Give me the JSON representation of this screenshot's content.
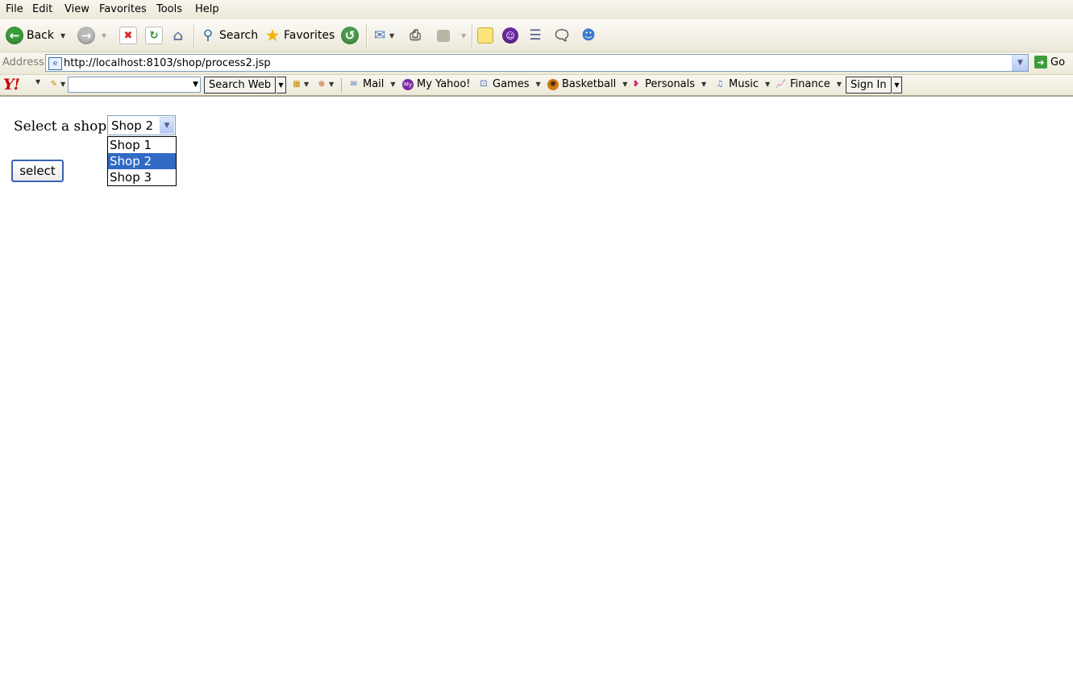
{
  "menu": [
    "File",
    "Edit",
    "View",
    "Favorites",
    "Tools",
    "Help"
  ],
  "toolbar": {
    "back_label": "Back",
    "search_label": "Search",
    "favorites_label": "Favorites"
  },
  "address": {
    "label": "Address",
    "url": "http://localhost:8103/shop/process2.jsp",
    "go_label": "Go"
  },
  "yahoo": {
    "logo": "Y!",
    "search_button": "Search Web",
    "items": [
      "Mail",
      "My Yahoo!",
      "Games",
      "Basketball",
      "Personals",
      "Music",
      "Finance"
    ],
    "sign_in": "Sign In"
  },
  "form": {
    "label": "Select a shop:",
    "selected": "Shop 2",
    "options": [
      "Shop 1",
      "Shop 2",
      "Shop 3"
    ],
    "submit_label": "select"
  },
  "colors": {
    "selection": "#316ac5",
    "chrome": "#ece9d8",
    "yahoo_red": "#cc0000"
  }
}
